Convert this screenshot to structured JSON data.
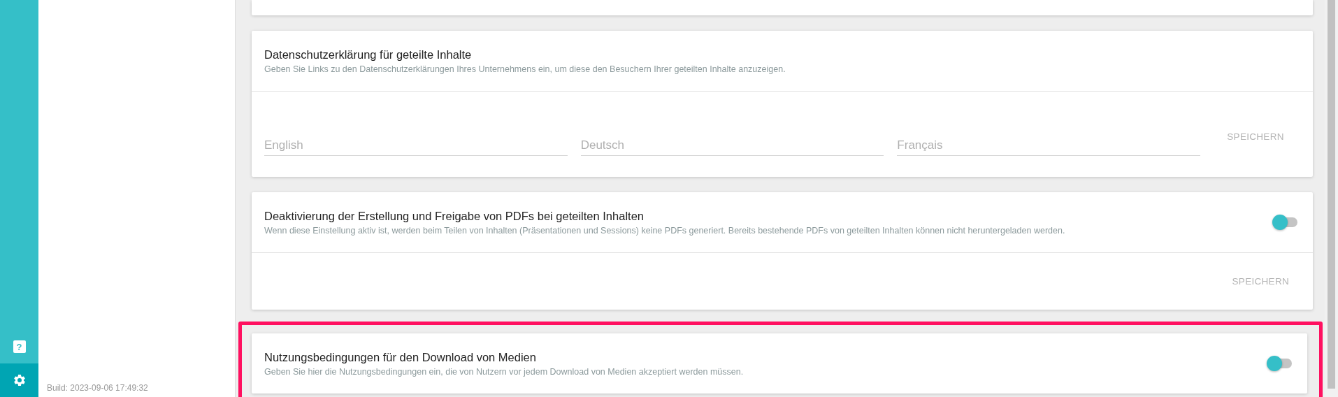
{
  "sidebar": {
    "nav": [
      {
        "kind": "help",
        "icon": "?",
        "selected": false
      },
      {
        "kind": "settings",
        "selected": true
      }
    ],
    "build": "Build: 2023-09-06 17:49:32"
  },
  "cards": [
    {
      "kind": "fields",
      "title": "Datenschutzerklärung für geteilte Inhalte",
      "description": "Geben Sie Links zu den Datenschutzerklärungen Ihres Unternehmens ein, um diese den Besuchern Ihrer geteilten Inhalte anzuzeigen.",
      "fields": [
        {
          "placeholder": "English"
        },
        {
          "placeholder": "Deutsch"
        },
        {
          "placeholder": "Français"
        }
      ],
      "button": "SPEICHERN",
      "highlighted": false
    },
    {
      "kind": "toggle",
      "title": "Deaktivierung der Erstellung und Freigabe von PDFs bei geteilten Inhalten",
      "description": "Wenn diese Einstellung aktiv ist, werden beim Teilen von Inhalten (Präsentationen und Sessions) keine PDFs generiert. Bereits bestehende PDFs von geteilten Inhalten können nicht heruntergeladen werden.",
      "on": false,
      "button": "SPEICHERN",
      "highlighted": false
    },
    {
      "kind": "toggle",
      "title": "Nutzungsbedingungen für den Download von Medien",
      "description": "Geben Sie hier die Nutzungsbedingungen ein, die von Nutzern vor jedem Download von Medien akzeptiert werden müssen.",
      "on": false,
      "highlighted": true
    }
  ]
}
